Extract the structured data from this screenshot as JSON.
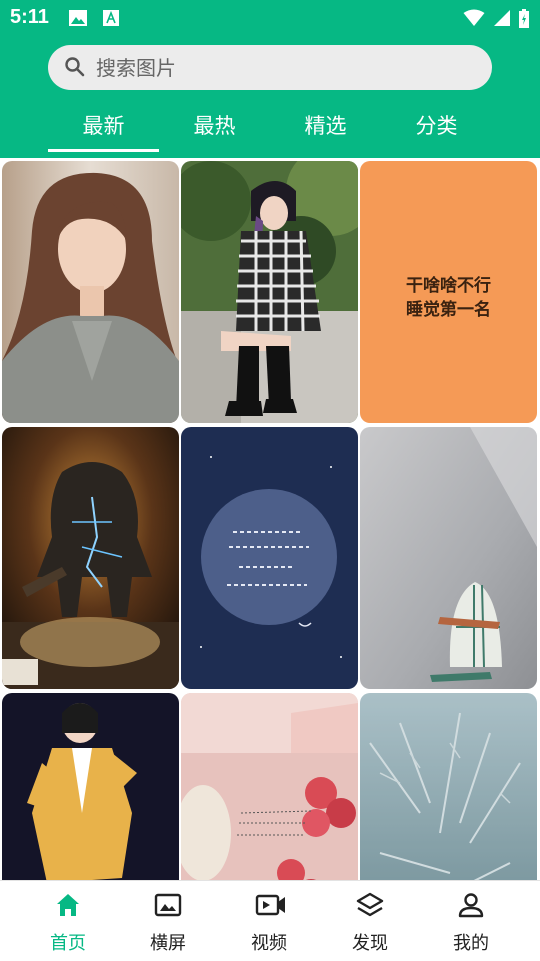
{
  "status_bar": {
    "time": "5:11"
  },
  "search": {
    "placeholder": "搜索图片"
  },
  "tabs": [
    {
      "label": "最新",
      "active": true
    },
    {
      "label": "最热",
      "active": false
    },
    {
      "label": "精选",
      "active": false
    },
    {
      "label": "分类",
      "active": false
    }
  ],
  "gallery": {
    "items": [
      {
        "subject": "woman-portrait"
      },
      {
        "subject": "woman-sitting-boots"
      },
      {
        "subject": "orange-text-card",
        "text_line1": "干啥啥不行",
        "text_line2": "睡觉第一名"
      },
      {
        "subject": "movie-poster-kong"
      },
      {
        "subject": "moon-quote-card"
      },
      {
        "subject": "surfboard-wall"
      },
      {
        "subject": "woman-yellow-blazer"
      },
      {
        "subject": "strawberries-package"
      },
      {
        "subject": "frost-window"
      }
    ]
  },
  "bottom_nav": [
    {
      "label": "首页",
      "icon": "home-icon",
      "active": true
    },
    {
      "label": "横屏",
      "icon": "image-icon",
      "active": false
    },
    {
      "label": "视频",
      "icon": "video-icon",
      "active": false
    },
    {
      "label": "发现",
      "icon": "layers-icon",
      "active": false
    },
    {
      "label": "我的",
      "icon": "person-icon",
      "active": false
    }
  ],
  "colors": {
    "accent": "#06b884",
    "header_bg": "#06b884",
    "inactive_text": "#222222"
  }
}
